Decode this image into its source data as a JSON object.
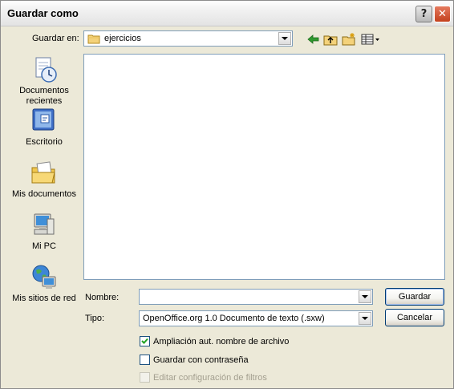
{
  "window": {
    "title": "Guardar como",
    "help_symbol": "?",
    "close_symbol": "✕"
  },
  "location": {
    "label": "Guardar en:",
    "value": "ejercicios"
  },
  "toolbar": {
    "icons": [
      "back-icon",
      "up-folder-icon",
      "new-folder-icon",
      "view-menu-icon"
    ]
  },
  "places": [
    {
      "id": "recent",
      "label": "Documentos recientes",
      "icon": "recent-documents-icon"
    },
    {
      "id": "desktop",
      "label": "Escritorio",
      "icon": "desktop-icon"
    },
    {
      "id": "mydocs",
      "label": "Mis documentos",
      "icon": "my-documents-icon"
    },
    {
      "id": "mypc",
      "label": "Mi PC",
      "icon": "my-computer-icon"
    },
    {
      "id": "network",
      "label": "Mis sitios de red",
      "icon": "network-places-icon"
    }
  ],
  "filename": {
    "label": "Nombre:",
    "value": ""
  },
  "filetype": {
    "label": "Tipo:",
    "value": "OpenOffice.org 1.0 Documento de texto (.sxw)"
  },
  "buttons": {
    "save": "Guardar",
    "cancel": "Cancelar"
  },
  "options": {
    "auto_extension": {
      "label": "Ampliación aut. nombre de archivo",
      "checked": true
    },
    "save_with_password": {
      "label": "Guardar con contraseña",
      "checked": false
    },
    "edit_filter_settings": {
      "label": "Editar configuración de filtros",
      "checked": false,
      "disabled": true
    }
  }
}
